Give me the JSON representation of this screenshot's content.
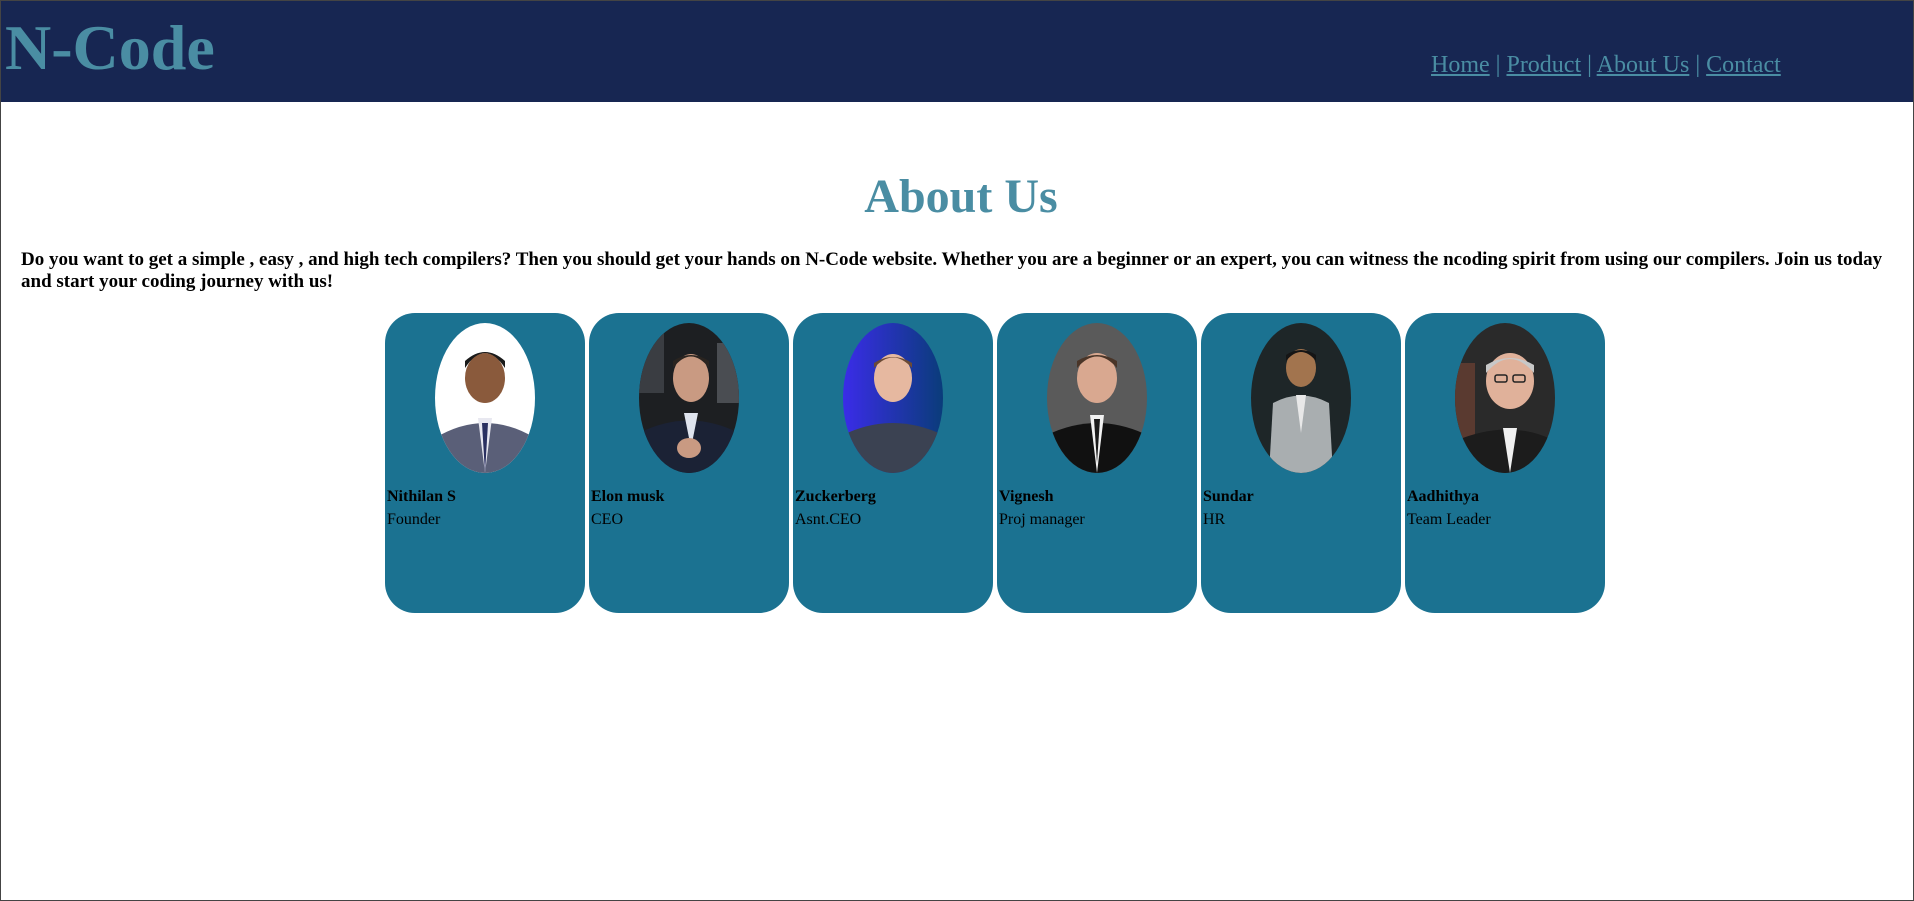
{
  "brand": {
    "name": "N-Code"
  },
  "nav": {
    "home": "Home",
    "product": "Product",
    "about": "About Us",
    "contact": "Contact",
    "separator": "|"
  },
  "page": {
    "title": "About Us",
    "intro": "Do you want to get a simple , easy , and high tech compilers? Then you should get your hands on N-Code website. Whether you are a beginner or an expert, you can witness the ncoding spirit from using our compilers. Join us today and start your coding journey with us!"
  },
  "colors": {
    "header_bg": "#172652",
    "accent": "#4a8da3",
    "card_bg": "#1b7291"
  },
  "team": [
    {
      "name": "Nithilan S",
      "role": "Founder",
      "icon": "person-photo"
    },
    {
      "name": "Elon musk",
      "role": "CEO",
      "icon": "person-photo"
    },
    {
      "name": "Zuckerberg",
      "role": "Asnt.CEO",
      "icon": "person-photo"
    },
    {
      "name": "Vignesh",
      "role": "Proj manager",
      "icon": "person-photo"
    },
    {
      "name": "Sundar",
      "role": "HR",
      "icon": "person-photo"
    },
    {
      "name": "Aadhithya",
      "role": "Team Leader",
      "icon": "person-photo"
    }
  ]
}
